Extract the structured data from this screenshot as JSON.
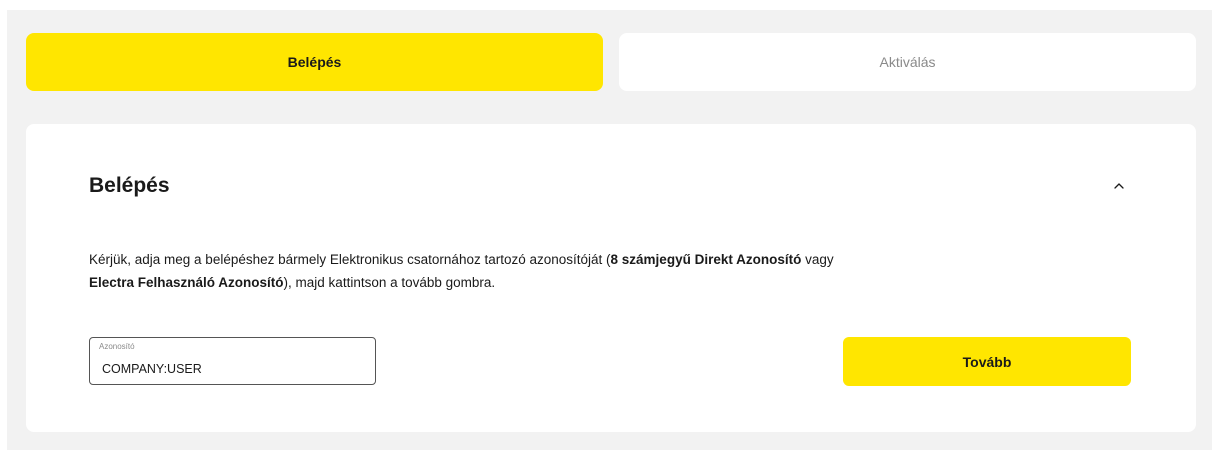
{
  "tabs": {
    "login": "Belépés",
    "activation": "Aktiválás"
  },
  "card": {
    "title": "Belépés",
    "collapse_icon": "chevron-up-icon",
    "description": {
      "part1": "Kérjük, adja meg a belépéshez bármely Elektronikus csatornához tartozó azonosítóját (",
      "bold1": "8 számjegyű Direkt Azonosító",
      "part2": " vagy",
      "bold2": "Electra Felhasználó Azonosító",
      "part3": "), majd kattintson a tovább gombra."
    },
    "input": {
      "label": "Azonosító",
      "value": "COMPANY:USER"
    },
    "next_label": "Tovább"
  },
  "colors": {
    "accent": "#ffe600",
    "background": "#f2f2f2",
    "card": "#ffffff"
  }
}
